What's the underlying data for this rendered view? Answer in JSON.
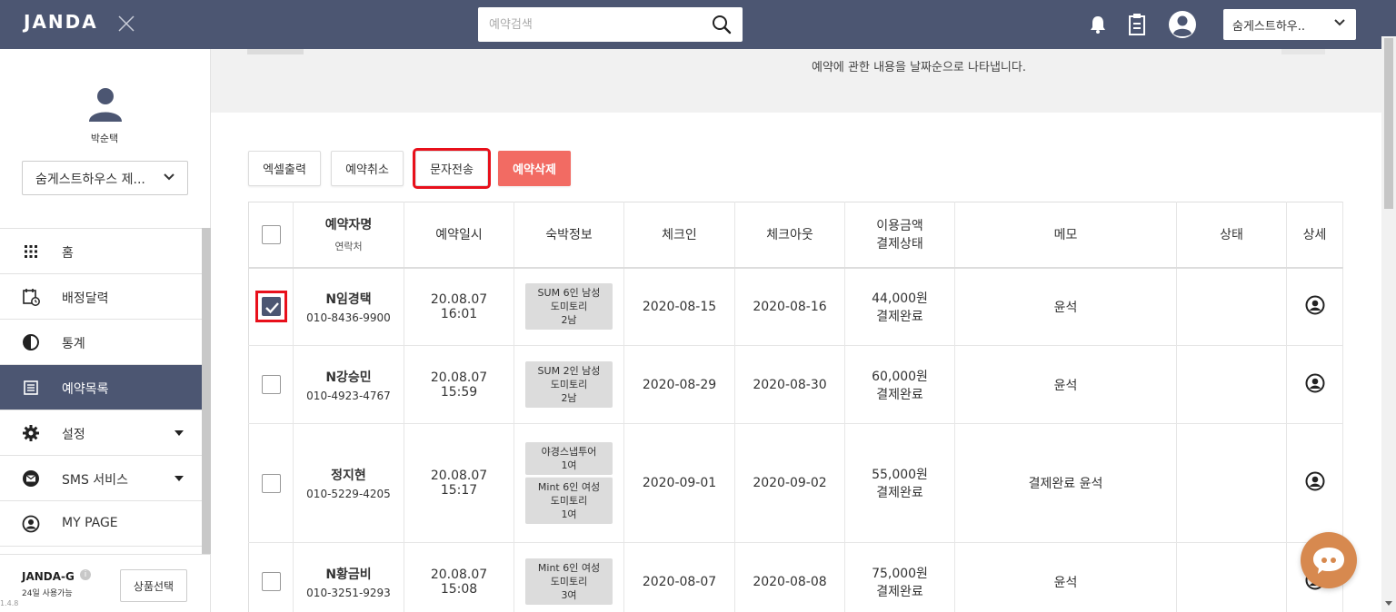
{
  "brand": {
    "logo": "JANDA"
  },
  "header": {
    "search": {
      "placeholder": "예약검색",
      "value": ""
    },
    "store_select": "숨게스트하우..",
    "icons": [
      "bell-icon",
      "clipboard-icon",
      "user-circle-icon",
      "chevron-down-icon",
      "search-icon",
      "close-icon"
    ]
  },
  "sidebar": {
    "user_name": "박순택",
    "store_select": "숨게스트하우스 제...",
    "items": [
      {
        "label": "홈",
        "icon": "grid-icon",
        "active": false,
        "has_submenu": false
      },
      {
        "label": "배정달력",
        "icon": "calendar-clock-icon",
        "active": false,
        "has_submenu": false
      },
      {
        "label": "통계",
        "icon": "pie-chart-icon",
        "active": false,
        "has_submenu": false
      },
      {
        "label": "예약목록",
        "icon": "list-icon",
        "active": true,
        "has_submenu": false
      },
      {
        "label": "설정",
        "icon": "gear-icon",
        "active": false,
        "has_submenu": true
      },
      {
        "label": "SMS 서비스",
        "icon": "mail-icon",
        "active": false,
        "has_submenu": true
      },
      {
        "label": "MY PAGE",
        "icon": "user-circle-icon",
        "active": false,
        "has_submenu": false
      }
    ],
    "footer": {
      "plan_name": "JANDA-G",
      "plan_days": "24일 사용가능",
      "plan_button": "상품선택",
      "version": "1.4.8"
    }
  },
  "main": {
    "banner_text": "예약에 관한 내용을 날짜순으로 나타냅니다.",
    "actions": {
      "excel": "엑셀출력",
      "cancel": "예약취소",
      "sms": "문자전송",
      "delete": "예약삭제"
    },
    "table": {
      "headers": {
        "guest_main": "예약자명",
        "guest_sub": "연락처",
        "booked_at": "예약일시",
        "room": "숙박정보",
        "checkin": "체크인",
        "checkout": "체크아웃",
        "amount_main": "이용금액",
        "amount_sub": "결제상태",
        "memo": "메모",
        "status": "상태",
        "detail": "상세"
      },
      "rows": [
        {
          "checked": true,
          "name": "N임경택",
          "phone": "010-8436-9900",
          "date": "20.08.07",
          "time": "16:01",
          "rooms": [
            {
              "line1": "SUM 6인 남성",
              "line2": "도미토리",
              "line3": "2남"
            }
          ],
          "checkin": "2020-08-15",
          "checkout": "2020-08-16",
          "amount": "44,000원",
          "pay_status": "결제완료",
          "memo": "윤석",
          "status": ""
        },
        {
          "checked": false,
          "name": "N강승민",
          "phone": "010-4923-4767",
          "date": "20.08.07",
          "time": "15:59",
          "rooms": [
            {
              "line1": "SUM 2인 남성",
              "line2": "도미토리",
              "line3": "2남"
            }
          ],
          "checkin": "2020-08-29",
          "checkout": "2020-08-30",
          "amount": "60,000원",
          "pay_status": "결제완료",
          "memo": "윤석",
          "status": ""
        },
        {
          "checked": false,
          "name": "정지현",
          "phone": "010-5229-4205",
          "date": "20.08.07",
          "time": "15:17",
          "rooms": [
            {
              "line1": "야경스냅투어",
              "line2": "1여",
              "line3": ""
            },
            {
              "line1": "Mint 6인 여성",
              "line2": "도미토리",
              "line3": "1여"
            }
          ],
          "checkin": "2020-09-01",
          "checkout": "2020-09-02",
          "amount": "55,000원",
          "pay_status": "결제완료",
          "memo": "결제완료 윤석",
          "status": ""
        },
        {
          "checked": false,
          "name": "N황금비",
          "phone": "010-3251-9293",
          "date": "20.08.07",
          "time": "15:08",
          "rooms": [
            {
              "line1": "Mint 6인 여성",
              "line2": "도미토리",
              "line3": "3여"
            }
          ],
          "checkin": "2020-08-07",
          "checkout": "2020-08-08",
          "amount": "75,000원",
          "pay_status": "결제완료",
          "memo": "윤석",
          "status": ""
        }
      ]
    }
  },
  "colors": {
    "topbar": "#4c5672",
    "active_nav": "#4c5672",
    "danger_button": "#f26b63",
    "highlight_outline": "#e8101b",
    "chat_fab": "#d7894f"
  }
}
